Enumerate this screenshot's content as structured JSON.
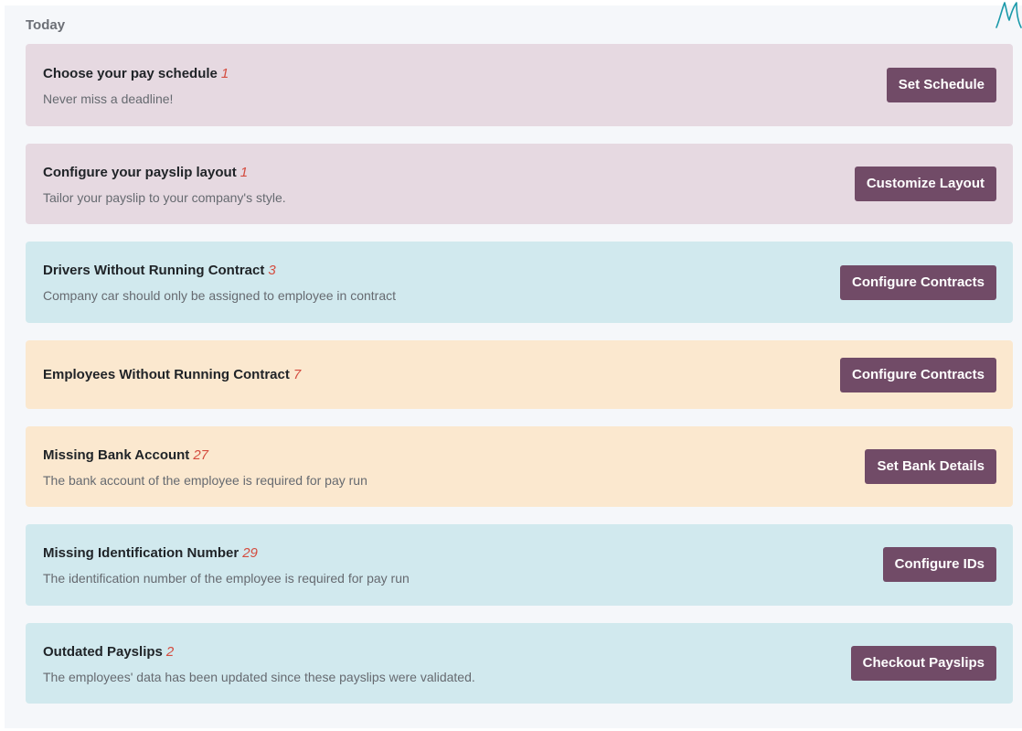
{
  "section": {
    "title": "Today"
  },
  "cards": [
    {
      "title": "Choose your pay schedule",
      "count": "1",
      "description": "Never miss a deadline!",
      "button": "Set Schedule"
    },
    {
      "title": "Configure your payslip layout",
      "count": "1",
      "description": "Tailor your payslip to your company's style.",
      "button": "Customize Layout"
    },
    {
      "title": "Drivers Without Running Contract",
      "count": "3",
      "description": "Company car should only be assigned to employee in contract",
      "button": "Configure Contracts"
    },
    {
      "title": "Employees Without Running Contract",
      "count": "7",
      "description": "",
      "button": "Configure Contracts"
    },
    {
      "title": "Missing Bank Account",
      "count": "27",
      "description": "The bank account of the employee is required for pay run",
      "button": "Set Bank Details"
    },
    {
      "title": "Missing Identification Number",
      "count": "29",
      "description": "The identification number of the employee is required for pay run",
      "button": "Configure IDs"
    },
    {
      "title": "Outdated Payslips",
      "count": "2",
      "description": "The employees' data has been updated since these payslips were validated.",
      "button": "Checkout Payslips"
    }
  ],
  "colors": {
    "danger_bg": "#e6d9e1",
    "info_bg": "#d1e9ee",
    "warning_bg": "#fbe8cf",
    "button_bg": "#714b67",
    "count_text": "#d44c3f",
    "logo_stroke": "#1b9aaa"
  },
  "icons": {
    "corner_mark": "handwritten-logo-icon"
  }
}
